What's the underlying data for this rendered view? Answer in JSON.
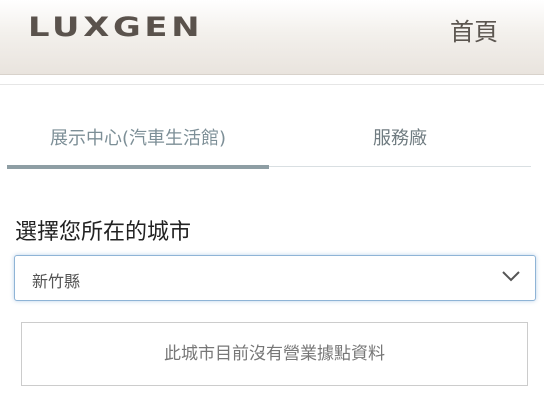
{
  "header": {
    "logo": "LUXGEN",
    "home_link": "首頁"
  },
  "tabs": [
    {
      "label": "展示中心(汽車生活館)",
      "active": true
    },
    {
      "label": "服務廠",
      "active": false
    }
  ],
  "city": {
    "label": "選擇您所在的城市",
    "selected": "新竹縣"
  },
  "notice": {
    "text": "此城市目前沒有營業據點資料"
  },
  "icons": {
    "dropdown": "chevron-down-icon"
  }
}
